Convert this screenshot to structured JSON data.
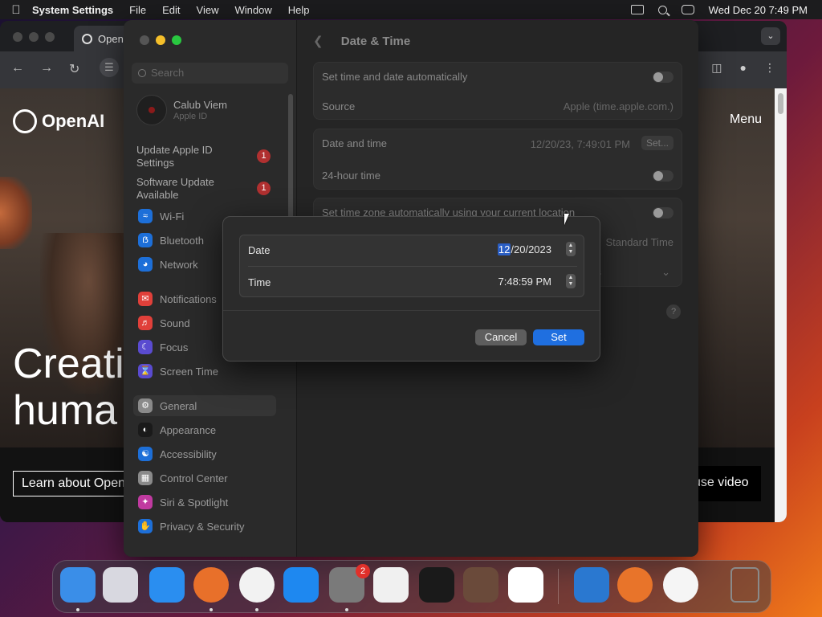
{
  "menubar": {
    "app_name": "System Settings",
    "items": [
      "File",
      "Edit",
      "View",
      "Window",
      "Help"
    ],
    "datetime": "Wed Dec 20  7:49 PM"
  },
  "browser": {
    "tab_title": "Open",
    "logo_text": "OpenAI",
    "menu_label": "Menu",
    "hero_line1": "Creati",
    "hero_line2": "huma",
    "learn_button": "Learn about Open",
    "pause_button": "use video"
  },
  "settings": {
    "search_placeholder": "Search",
    "account": {
      "name": "Calub Viem",
      "subtitle": "Apple ID"
    },
    "notices": [
      {
        "label": "Update Apple ID Settings",
        "badge": "1"
      },
      {
        "label": "Software Update Available",
        "badge": "1"
      }
    ],
    "sidebar": [
      {
        "label": "Wi-Fi",
        "icon": "wifi-icon",
        "color": "#1d6fd8"
      },
      {
        "label": "Bluetooth",
        "icon": "bluetooth-icon",
        "color": "#1d6fd8"
      },
      {
        "label": "Network",
        "icon": "globe-icon",
        "color": "#1d6fd8"
      },
      {
        "label": "Notifications",
        "icon": "bell-icon",
        "color": "#e0403a"
      },
      {
        "label": "Sound",
        "icon": "speaker-icon",
        "color": "#e0403a"
      },
      {
        "label": "Focus",
        "icon": "moon-icon",
        "color": "#5a4bd0"
      },
      {
        "label": "Screen Time",
        "icon": "hourglass-icon",
        "color": "#5a4bd0"
      },
      {
        "label": "General",
        "icon": "gear-icon",
        "color": "#8a8a8a"
      },
      {
        "label": "Appearance",
        "icon": "appearance-icon",
        "color": "#1a1a1a"
      },
      {
        "label": "Accessibility",
        "icon": "accessibility-icon",
        "color": "#1d6fd8"
      },
      {
        "label": "Control Center",
        "icon": "control-center-icon",
        "color": "#8a8a8a"
      },
      {
        "label": "Siri & Spotlight",
        "icon": "siri-icon",
        "color": "#c03aa0"
      },
      {
        "label": "Privacy & Security",
        "icon": "hand-icon",
        "color": "#1d6fd8"
      }
    ],
    "pane": {
      "title": "Date & Time",
      "auto_time_label": "Set time and date automatically",
      "source_label": "Source",
      "source_value": "Apple (time.apple.com.)",
      "date_time_label": "Date and time",
      "date_time_value": "12/20/23, 7:49:01 PM",
      "set_button": "Set...",
      "hour24_label": "24-hour time",
      "auto_tz_label": "Set time zone automatically using your current location",
      "tz_value": "Standard Time",
      "closest_city": "tates",
      "help": "?"
    }
  },
  "sheet": {
    "date_label": "Date",
    "date_selected": "12",
    "date_rest": "/20/2023",
    "time_label": "Time",
    "time_value": "7:48:59 PM",
    "cancel": "Cancel",
    "set": "Set"
  },
  "dock": {
    "apps": [
      {
        "name": "Finder",
        "color": "#3a8ee8",
        "running": true
      },
      {
        "name": "Launchpad",
        "color": "#d8d8e0",
        "running": false
      },
      {
        "name": "Safari",
        "color": "#2a8ef0",
        "running": false
      },
      {
        "name": "Firefox",
        "color": "#e8702a",
        "running": true
      },
      {
        "name": "Chrome",
        "color": "#f2f2f2",
        "running": true
      },
      {
        "name": "App Store",
        "color": "#1e88f0",
        "running": false
      },
      {
        "name": "System Settings",
        "color": "#7a7a7a",
        "running": true
      },
      {
        "name": "TextEdit",
        "color": "#f0f0f0",
        "running": false
      },
      {
        "name": "Terminal",
        "color": "#1a1a1a",
        "running": false
      },
      {
        "name": "GarageBand",
        "color": "#6a4a3a",
        "running": false
      },
      {
        "name": "VS Code",
        "color": "#ffffff",
        "running": false
      },
      {
        "name": "Weather",
        "color": "#2a78d0",
        "running": false
      },
      {
        "name": "Alfred",
        "color": "#e8742a",
        "running": false
      },
      {
        "name": "Clock",
        "color": "#f5f5f5",
        "running": false
      },
      {
        "name": "Trash",
        "color": "#8a8a8a",
        "running": false
      }
    ],
    "settings_badge": "2"
  }
}
